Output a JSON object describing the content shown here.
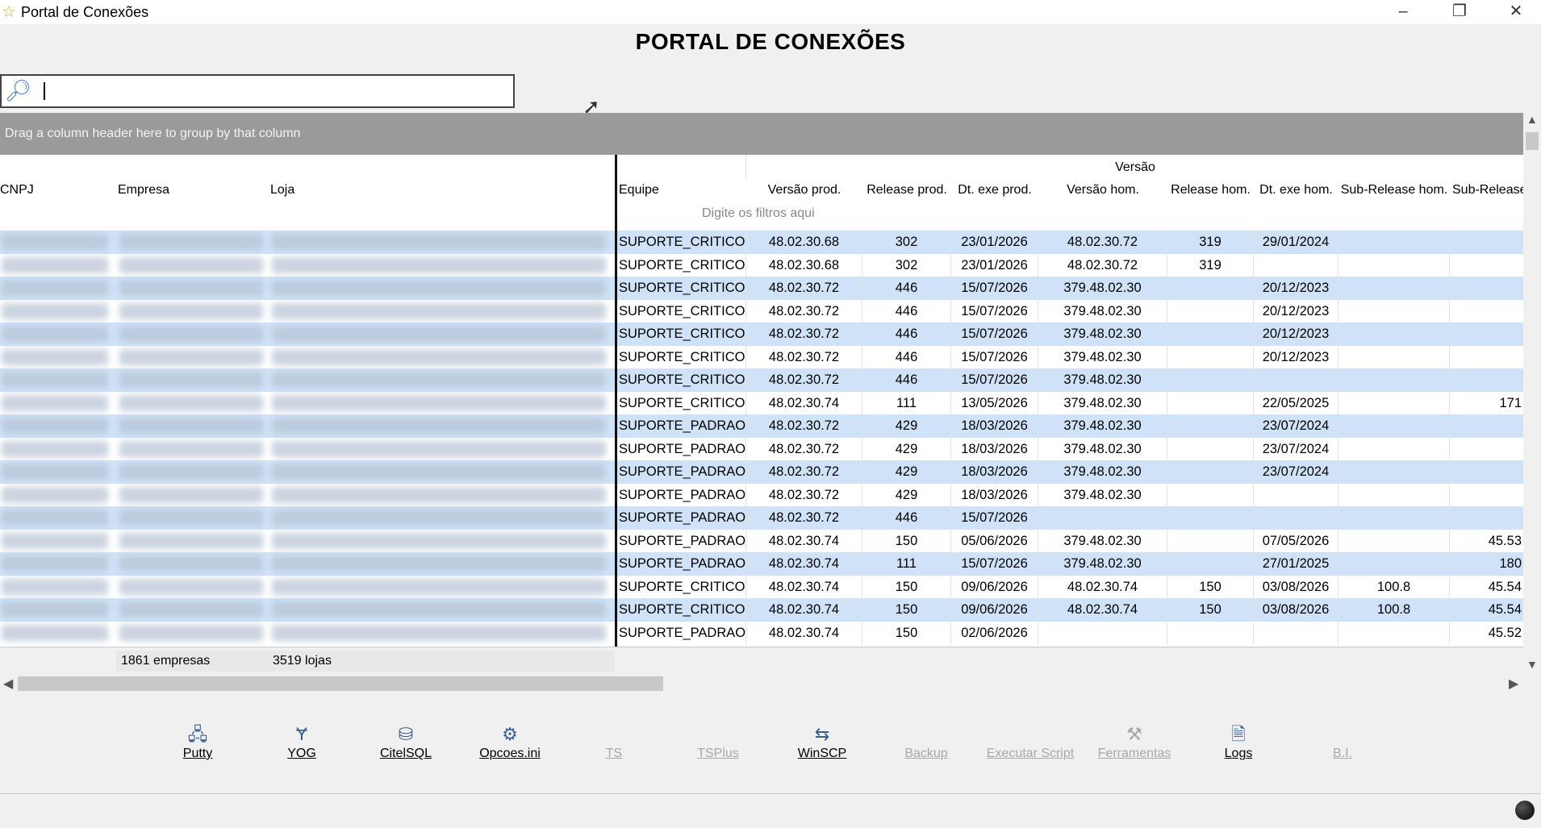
{
  "window": {
    "title": "Portal de Conexões"
  },
  "header": {
    "title": "PORTAL DE CONEXÕES"
  },
  "search": {
    "value": "",
    "placeholder": ""
  },
  "group_panel": {
    "hint": "Drag a column header here to group by that column"
  },
  "grid": {
    "band_label": "Versão",
    "filter_hint": "Digite os filtros aqui",
    "columns": [
      "CNPJ",
      "Empresa",
      "Loja",
      "Equipe",
      "Versão prod.",
      "Release prod.",
      "Dt. exe prod.",
      "Versão hom.",
      "Release hom.",
      "Dt. exe hom.",
      "Sub-Release hom.",
      "Sub-Release"
    ],
    "rows": [
      [
        "SUPORTE_CRITICO",
        "48.02.30.68",
        "302",
        "23/01/2026",
        "48.02.30.72",
        "319",
        "29/01/2024",
        "",
        ""
      ],
      [
        "SUPORTE_CRITICO",
        "48.02.30.68",
        "302",
        "23/01/2026",
        "48.02.30.72",
        "319",
        "",
        "",
        ""
      ],
      [
        "SUPORTE_CRITICO",
        "48.02.30.72",
        "446",
        "15/07/2026",
        "379.48.02.30",
        "",
        "20/12/2023",
        "",
        ""
      ],
      [
        "SUPORTE_CRITICO",
        "48.02.30.72",
        "446",
        "15/07/2026",
        "379.48.02.30",
        "",
        "20/12/2023",
        "",
        ""
      ],
      [
        "SUPORTE_CRITICO",
        "48.02.30.72",
        "446",
        "15/07/2026",
        "379.48.02.30",
        "",
        "20/12/2023",
        "",
        ""
      ],
      [
        "SUPORTE_CRITICO",
        "48.02.30.72",
        "446",
        "15/07/2026",
        "379.48.02.30",
        "",
        "20/12/2023",
        "",
        ""
      ],
      [
        "SUPORTE_CRITICO",
        "48.02.30.72",
        "446",
        "15/07/2026",
        "379.48.02.30",
        "",
        "",
        "",
        ""
      ],
      [
        "SUPORTE_CRITICO",
        "48.02.30.74",
        "111",
        "13/05/2026",
        "379.48.02.30",
        "",
        "22/05/2025",
        "",
        "171"
      ],
      [
        "SUPORTE_PADRAO",
        "48.02.30.72",
        "429",
        "18/03/2026",
        "379.48.02.30",
        "",
        "23/07/2024",
        "",
        ""
      ],
      [
        "SUPORTE_PADRAO",
        "48.02.30.72",
        "429",
        "18/03/2026",
        "379.48.02.30",
        "",
        "23/07/2024",
        "",
        ""
      ],
      [
        "SUPORTE_PADRAO",
        "48.02.30.72",
        "429",
        "18/03/2026",
        "379.48.02.30",
        "",
        "23/07/2024",
        "",
        ""
      ],
      [
        "SUPORTE_PADRAO",
        "48.02.30.72",
        "429",
        "18/03/2026",
        "379.48.02.30",
        "",
        "",
        "",
        ""
      ],
      [
        "SUPORTE_PADRAO",
        "48.02.30.72",
        "446",
        "15/07/2026",
        "",
        "",
        "",
        "",
        ""
      ],
      [
        "SUPORTE_PADRAO",
        "48.02.30.74",
        "150",
        "05/06/2026",
        "379.48.02.30",
        "",
        "07/05/2026",
        "",
        "45.53"
      ],
      [
        "SUPORTE_PADRAO",
        "48.02.30.74",
        "111",
        "15/07/2026",
        "379.48.02.30",
        "",
        "27/01/2025",
        "",
        "180"
      ],
      [
        "SUPORTE_CRITICO",
        "48.02.30.74",
        "150",
        "09/06/2026",
        "48.02.30.74",
        "150",
        "03/08/2026",
        "100.8",
        "45.54"
      ],
      [
        "SUPORTE_CRITICO",
        "48.02.30.74",
        "150",
        "09/06/2026",
        "48.02.30.74",
        "150",
        "03/08/2026",
        "100.8",
        "45.54"
      ],
      [
        "SUPORTE_PADRAO",
        "48.02.30.74",
        "150",
        "02/06/2026",
        "",
        "",
        "",
        "",
        "45.52"
      ]
    ],
    "footer": {
      "empresas": "1861 empresas",
      "lojas": "3519 lojas"
    }
  },
  "toolbar": [
    {
      "label": "Putty",
      "icon": "putty-icon",
      "enabled": true
    },
    {
      "label": "YOG",
      "icon": "yog-icon",
      "enabled": true
    },
    {
      "label": "CitelSQL",
      "icon": "database-icon",
      "enabled": true
    },
    {
      "label": "Opcoes.ini",
      "icon": "gear-icon",
      "enabled": true
    },
    {
      "label": "TS",
      "icon": "",
      "enabled": false
    },
    {
      "label": "TSPlus",
      "icon": "",
      "enabled": false
    },
    {
      "label": "WinSCP",
      "icon": "winscp-icon",
      "enabled": true
    },
    {
      "label": "Backup",
      "icon": "",
      "enabled": false
    },
    {
      "label": "Executar Script",
      "icon": "",
      "enabled": false
    },
    {
      "label": "Ferramentas",
      "icon": "tools-icon",
      "enabled": false
    },
    {
      "label": "Logs",
      "icon": "document-icon",
      "enabled": true
    },
    {
      "label": "B.I.",
      "icon": "",
      "enabled": false
    }
  ],
  "colors": {
    "row_alt": "#cfe2f8",
    "group_panel": "#9a9a9a",
    "accent": "#3b5c8e"
  }
}
